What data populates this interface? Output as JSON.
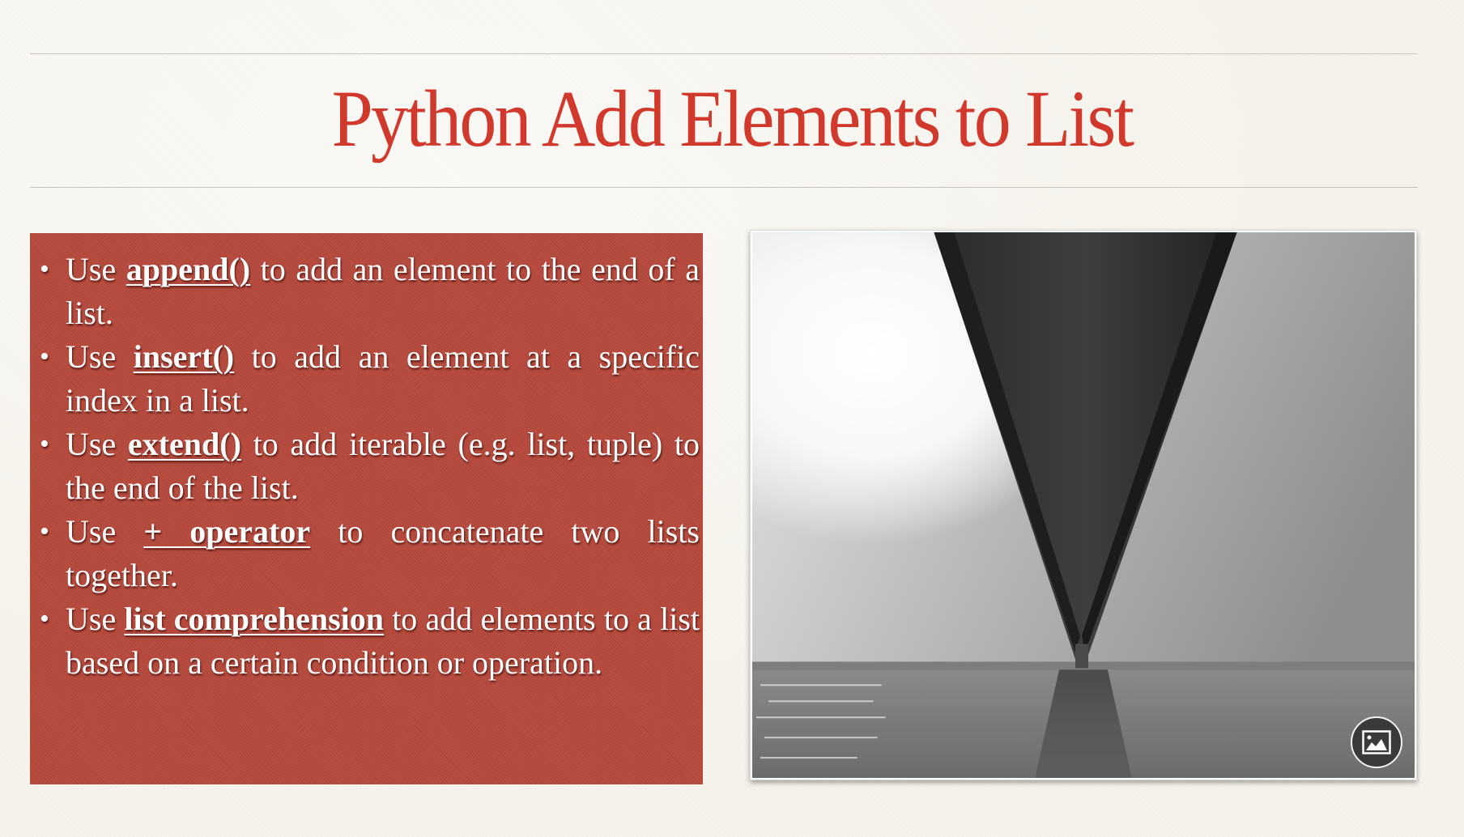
{
  "slide": {
    "title": "Python Add Elements to List",
    "title_color": "#d1392c",
    "panel_color": "#b84a3d",
    "bullets": [
      {
        "prefix": "Use ",
        "keyword": "append()",
        "suffix": " to add an element to the end of a list."
      },
      {
        "prefix": "Use ",
        "keyword": "insert()",
        "suffix": " to add an element at a specific index in a list."
      },
      {
        "prefix": "Use ",
        "keyword": "extend()",
        "suffix": " to add iterable (e.g. list, tuple) to the end of the list."
      },
      {
        "prefix": "Use ",
        "keyword": "+ operator",
        "suffix": " to concatenate two lists together."
      },
      {
        "prefix": "Use ",
        "keyword": "list comprehension",
        "suffix": " to add elements to a list based on a certain condition or operation."
      }
    ],
    "bullet_glyph": "•",
    "image": {
      "description": "Black-and-white photo looking up at the underside of a long suspension bridge deck converging over water",
      "badge_icon": "image-icon"
    }
  }
}
